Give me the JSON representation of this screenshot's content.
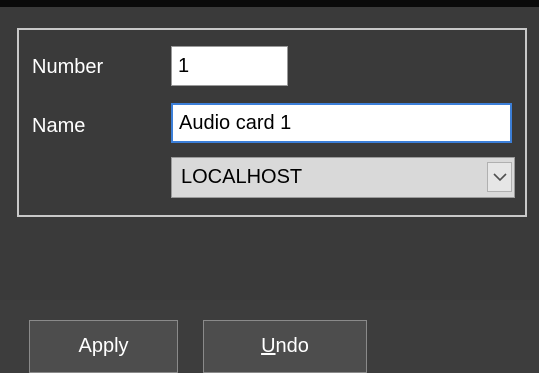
{
  "form": {
    "number_label": "Number",
    "number_value": "1",
    "name_label": "Name",
    "name_value": "Audio card 1",
    "host_value": "LOCALHOST"
  },
  "buttons": {
    "apply_label": "Apply",
    "undo_mnemonic": "U",
    "undo_rest": "ndo"
  },
  "icons": {
    "combo_arrow": "chevron-down-icon"
  },
  "colors": {
    "background": "#3a3a3a",
    "focus_border": "#3c7fd8",
    "group_border": "#c8c8c8"
  }
}
